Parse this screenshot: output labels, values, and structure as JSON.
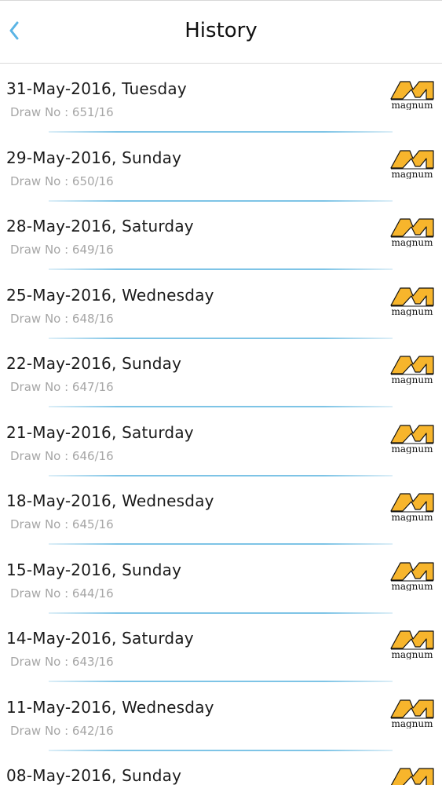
{
  "header": {
    "title": "History"
  },
  "logo_label": "magnum",
  "colors": {
    "accent": "#5ab4e5",
    "logo_fill": "#f7b52c",
    "divider": "#7ec4e6"
  },
  "draws": [
    {
      "date": "31-May-2016, Tuesday",
      "draw_no": "Draw No : 651/16"
    },
    {
      "date": "29-May-2016, Sunday",
      "draw_no": "Draw No : 650/16"
    },
    {
      "date": "28-May-2016, Saturday",
      "draw_no": "Draw No : 649/16"
    },
    {
      "date": "25-May-2016, Wednesday",
      "draw_no": "Draw No : 648/16"
    },
    {
      "date": "22-May-2016, Sunday",
      "draw_no": "Draw No : 647/16"
    },
    {
      "date": "21-May-2016, Saturday",
      "draw_no": "Draw No : 646/16"
    },
    {
      "date": "18-May-2016, Wednesday",
      "draw_no": "Draw No : 645/16"
    },
    {
      "date": "15-May-2016, Sunday",
      "draw_no": "Draw No : 644/16"
    },
    {
      "date": "14-May-2016, Saturday",
      "draw_no": "Draw No : 643/16"
    },
    {
      "date": "11-May-2016, Wednesday",
      "draw_no": "Draw No : 642/16"
    },
    {
      "date": "08-May-2016, Sunday",
      "draw_no": ""
    }
  ]
}
